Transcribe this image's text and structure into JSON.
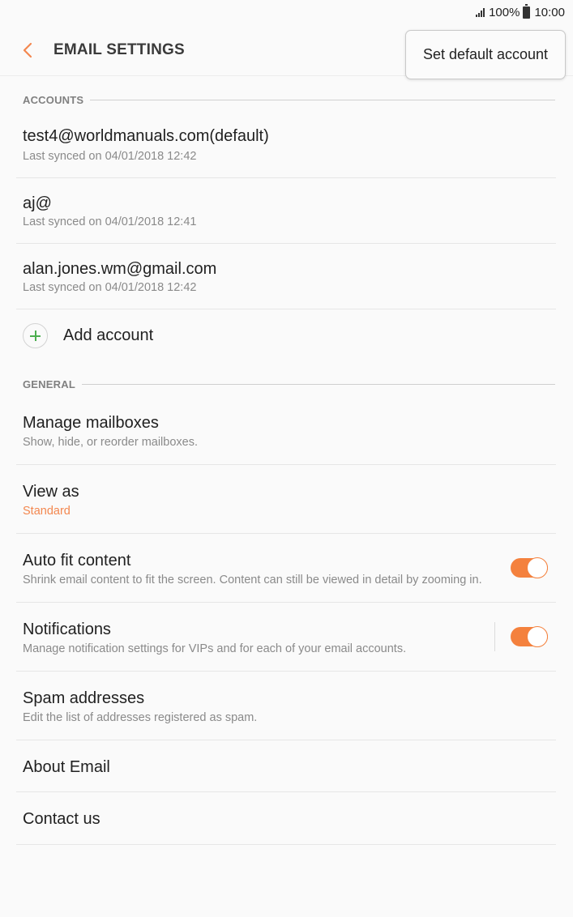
{
  "status_bar": {
    "battery": "100%",
    "time": "10:00"
  },
  "app_bar": {
    "title": "EMAIL SETTINGS",
    "back_icon": "chevron-left-icon"
  },
  "popup_menu": {
    "item": "Set default account"
  },
  "accounts": {
    "header": "ACCOUNTS",
    "items": [
      {
        "email": "test4@worldmanuals.com(default)",
        "sync": "Last synced on 04/01/2018  12:42"
      },
      {
        "email": "aj@",
        "sync": "Last synced on 04/01/2018  12:41"
      },
      {
        "email": "alan.jones.wm@gmail.com",
        "sync": "Last synced on 04/01/2018  12:42"
      }
    ],
    "add_label": "Add account"
  },
  "general": {
    "header": "GENERAL",
    "manage_mailboxes": {
      "title": "Manage mailboxes",
      "sub": "Show, hide, or reorder mailboxes."
    },
    "view_as": {
      "title": "View as",
      "value": "Standard"
    },
    "auto_fit": {
      "title": "Auto fit content",
      "sub": "Shrink email content to fit the screen. Content can still be viewed in detail by zooming in.",
      "enabled": true
    },
    "notifications": {
      "title": "Notifications",
      "sub": "Manage notification settings for VIPs and for each of your email accounts.",
      "enabled": true
    },
    "spam": {
      "title": "Spam addresses",
      "sub": "Edit the list of addresses registered as spam."
    },
    "about": {
      "title": "About Email"
    },
    "contact": {
      "title": "Contact us"
    }
  },
  "colors": {
    "accent": "#f4813d",
    "add_icon": "#4cae4f"
  }
}
